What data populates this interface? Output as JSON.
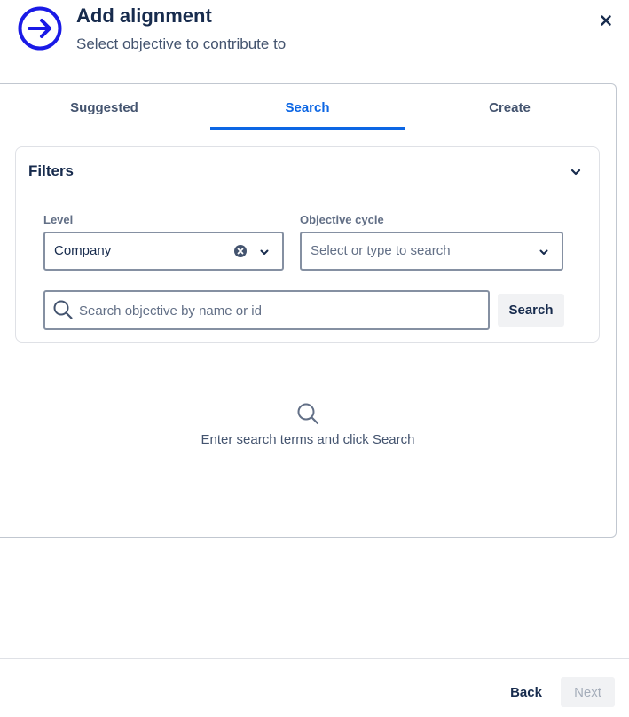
{
  "header": {
    "title": "Add alignment",
    "subtitle": "Select objective to contribute to",
    "icon": "arrow-right-circle-icon",
    "close_icon": "close-icon"
  },
  "tabs": [
    {
      "label": "Suggested",
      "active": false
    },
    {
      "label": "Search",
      "active": true
    },
    {
      "label": "Create",
      "active": false
    }
  ],
  "filters": {
    "title": "Filters",
    "toggle_icon": "chevron-down-icon",
    "level": {
      "label": "Level",
      "value": "Company"
    },
    "objective_cycle": {
      "label": "Objective cycle",
      "placeholder": "Select or type to search"
    },
    "search": {
      "placeholder": "Search objective by name or id",
      "value": "",
      "button_label": "Search"
    }
  },
  "empty_state": {
    "icon": "search-icon",
    "text": "Enter search terms and click Search"
  },
  "footer": {
    "back_label": "Back",
    "next_label": "Next",
    "next_disabled": true
  },
  "colors": {
    "accent": "#0c66e4",
    "header_icon": "#1a1ae6",
    "text_primary": "#172b4d",
    "text_secondary": "#44546f",
    "border": "#8590a2"
  }
}
